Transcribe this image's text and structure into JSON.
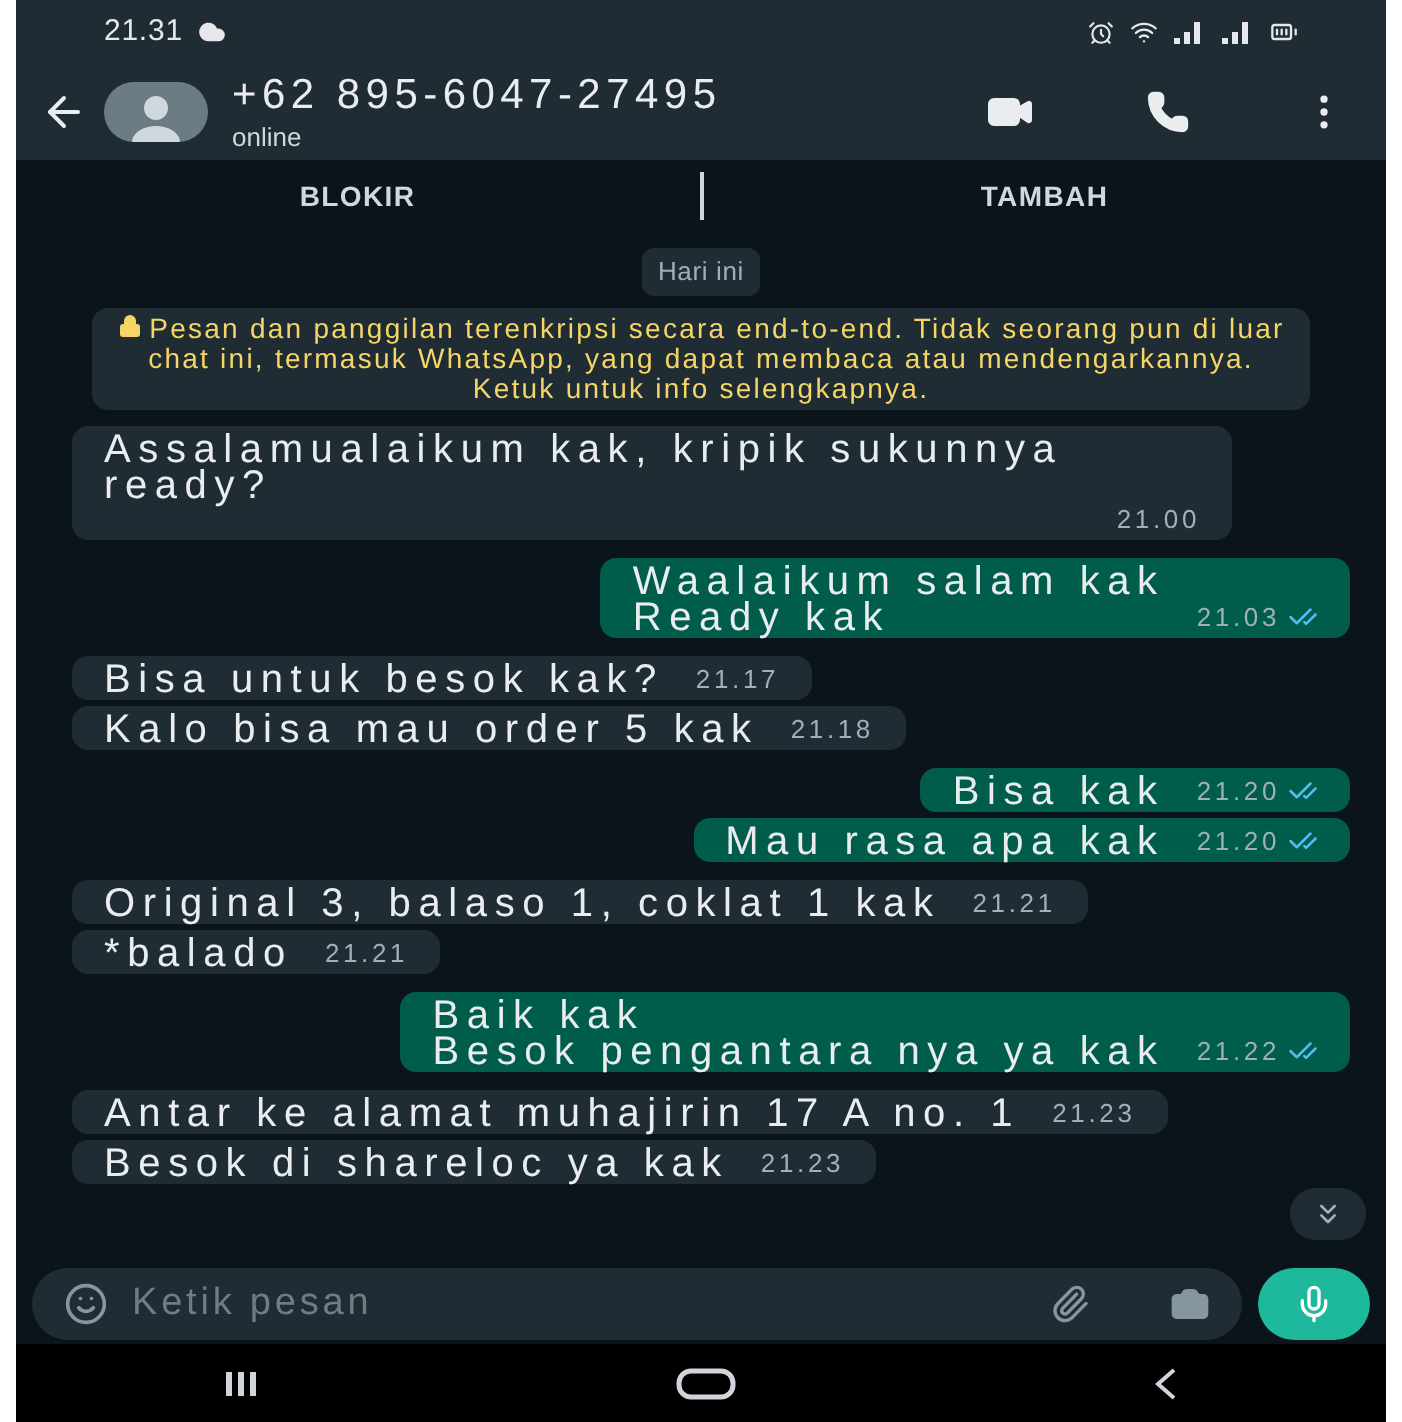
{
  "status_bar": {
    "time": "21.31"
  },
  "header": {
    "contact": "+62 895-6047-27495",
    "status": "online"
  },
  "actions": [
    "BLOKIR",
    "TAMBAH"
  ],
  "date_chip": "Hari ini",
  "encryption_notice": "Pesan dan panggilan terenkripsi secara end-to-end. Tidak seorang pun di luar chat ini, termasuk WhatsApp, yang dapat membaca atau mendengarkannya. Ketuk untuk info selengkapnya.",
  "messages": [
    {
      "kind": "incoming",
      "text": "Assalamualaikum kak, kripik sukunnya ready?",
      "time": "21.00"
    },
    {
      "kind": "outgoing",
      "text": "Waalaikum salam kak\nReady kak",
      "time": "21.03",
      "read": true
    },
    {
      "kind": "incoming",
      "text": "Bisa untuk besok kak?",
      "time": "21.17"
    },
    {
      "kind": "incoming",
      "text": "Kalo bisa mau order 5 kak",
      "time": "21.18"
    },
    {
      "kind": "outgoing",
      "text": "Bisa kak",
      "time": "21.20",
      "read": true
    },
    {
      "kind": "outgoing",
      "text": "Mau rasa apa kak",
      "time": "21.20",
      "read": true
    },
    {
      "kind": "incoming",
      "text": "Original 3, balaso 1, coklat 1 kak",
      "time": "21.21"
    },
    {
      "kind": "incoming",
      "text": "*balado",
      "time": "21.21"
    },
    {
      "kind": "outgoing",
      "text": "Baik kak\nBesok pengantara nya ya kak",
      "time": "21.22",
      "read": true
    },
    {
      "kind": "incoming",
      "text": "Antar ke alamat muhajirin 17 A no. 1",
      "time": "21.23"
    },
    {
      "kind": "incoming",
      "text": "Besok di shareloc ya kak",
      "time": "21.23"
    }
  ],
  "composer": {
    "placeholder": "Ketik pesan"
  }
}
